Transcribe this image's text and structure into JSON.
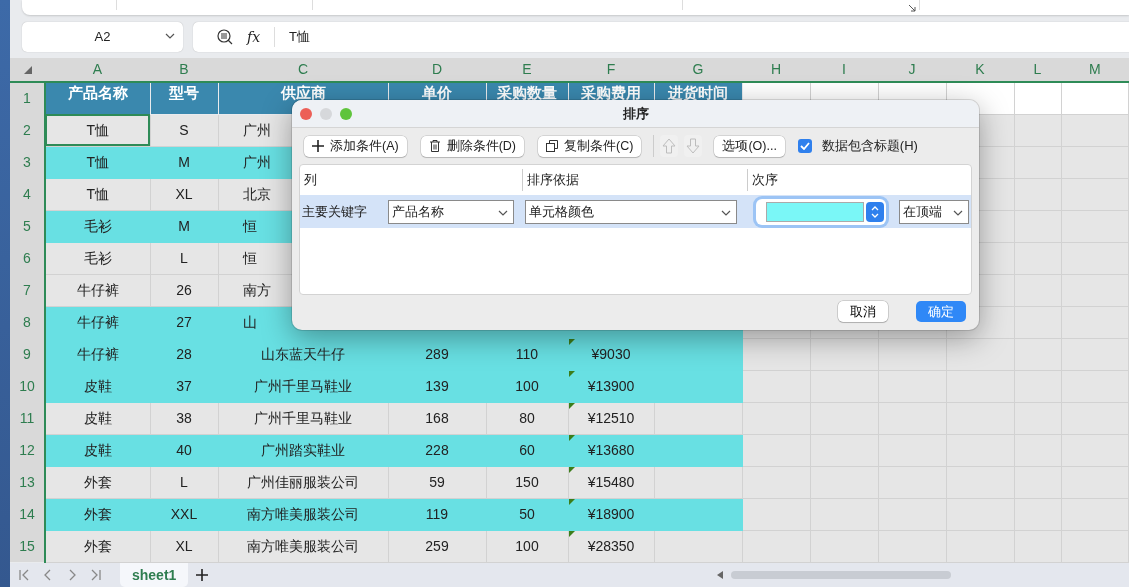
{
  "name_box": {
    "value": "A2"
  },
  "formula_bar": {
    "function_label": "fx",
    "value": "T恤"
  },
  "column_headers": [
    "A",
    "B",
    "C",
    "D",
    "E",
    "F",
    "G",
    "H",
    "I",
    "J",
    "K",
    "L",
    "M"
  ],
  "rows": [
    {
      "number": "1",
      "kind": "header",
      "color": "#3a88ae",
      "cells": [
        "产品名称",
        "型号",
        "供应商",
        "单价",
        "采购数量",
        "采购费用",
        "进货时间"
      ]
    },
    {
      "number": "2",
      "kind": "data",
      "color": "#e6e6e6",
      "covered": true,
      "active_cell": true,
      "cells": [
        "T恤",
        "S",
        "广州"
      ]
    },
    {
      "number": "3",
      "kind": "data",
      "color": "#68e0e3",
      "covered": true,
      "cells": [
        "T恤",
        "M",
        "广州"
      ]
    },
    {
      "number": "4",
      "kind": "data",
      "color": "#e6e6e6",
      "covered": true,
      "cells": [
        "T恤",
        "XL",
        "北京"
      ]
    },
    {
      "number": "5",
      "kind": "data",
      "color": "#68e0e3",
      "covered": true,
      "cells": [
        "毛衫",
        "M",
        "恒"
      ]
    },
    {
      "number": "6",
      "kind": "data",
      "color": "#e6e6e6",
      "covered": true,
      "cells": [
        "毛衫",
        "L",
        "恒"
      ]
    },
    {
      "number": "7",
      "kind": "data",
      "color": "#e6e6e6",
      "covered": true,
      "cells": [
        "牛仔裤",
        "26",
        "南方"
      ]
    },
    {
      "number": "8",
      "kind": "data",
      "color": "#68e0e3",
      "covered": true,
      "cells": [
        "牛仔裤",
        "27",
        "山"
      ]
    },
    {
      "number": "9",
      "kind": "data",
      "color": "#68e0e3",
      "flagged": true,
      "cells": [
        "牛仔裤",
        "28",
        "山东蓝天牛仔",
        "289",
        "110",
        "¥9030"
      ]
    },
    {
      "number": "10",
      "kind": "data",
      "color": "#68e0e3",
      "flagged": true,
      "cells": [
        "皮鞋",
        "37",
        "广州千里马鞋业",
        "139",
        "100",
        "¥13900"
      ]
    },
    {
      "number": "11",
      "kind": "data",
      "color": "#e6e6e6",
      "flagged": true,
      "cells": [
        "皮鞋",
        "38",
        "广州千里马鞋业",
        "168",
        "80",
        "¥12510"
      ]
    },
    {
      "number": "12",
      "kind": "data",
      "color": "#68e0e3",
      "flagged": true,
      "cells": [
        "皮鞋",
        "40",
        "广州踏实鞋业",
        "228",
        "60",
        "¥13680"
      ]
    },
    {
      "number": "13",
      "kind": "data",
      "color": "#e6e6e6",
      "flagged": true,
      "cells": [
        "外套",
        "L",
        "广州佳丽服装公司",
        "59",
        "150",
        "¥15480"
      ]
    },
    {
      "number": "14",
      "kind": "data",
      "color": "#68e0e3",
      "flagged": true,
      "cells": [
        "外套",
        "XXL",
        "南方唯美服装公司",
        "119",
        "50",
        "¥18900"
      ]
    },
    {
      "number": "15",
      "kind": "data",
      "color": "#e6e6e6",
      "flagged": true,
      "cells": [
        "外套",
        "XL",
        "南方唯美服装公司",
        "259",
        "100",
        "¥28350"
      ]
    }
  ],
  "sort_dialog": {
    "title": "排序",
    "toolbar": [
      {
        "kind": "add",
        "label": "添加条件(A)"
      },
      {
        "kind": "delete",
        "label": "删除条件(D)"
      },
      {
        "kind": "copy",
        "label": "复制条件(C)"
      },
      {
        "kind": "move-up",
        "disabled": true
      },
      {
        "kind": "move-down",
        "disabled": true
      },
      {
        "kind": "options",
        "label": "选项(O)..."
      }
    ],
    "header_checkbox": {
      "label": "数据包含标题(H)",
      "checked": true
    },
    "columns": [
      "列",
      "排序依据",
      "次序"
    ],
    "levels": [
      {
        "label": "主要关键字",
        "column": "产品名称",
        "sort_on": "单元格颜色",
        "color": "#7af7f7",
        "position": "在顶端",
        "selected": true
      }
    ],
    "buttons": [
      {
        "label": "取消",
        "primary": false
      },
      {
        "label": "确定",
        "primary": true
      }
    ]
  },
  "sheet_tabs": [
    {
      "label": "sheet1",
      "selected": true
    }
  ]
}
